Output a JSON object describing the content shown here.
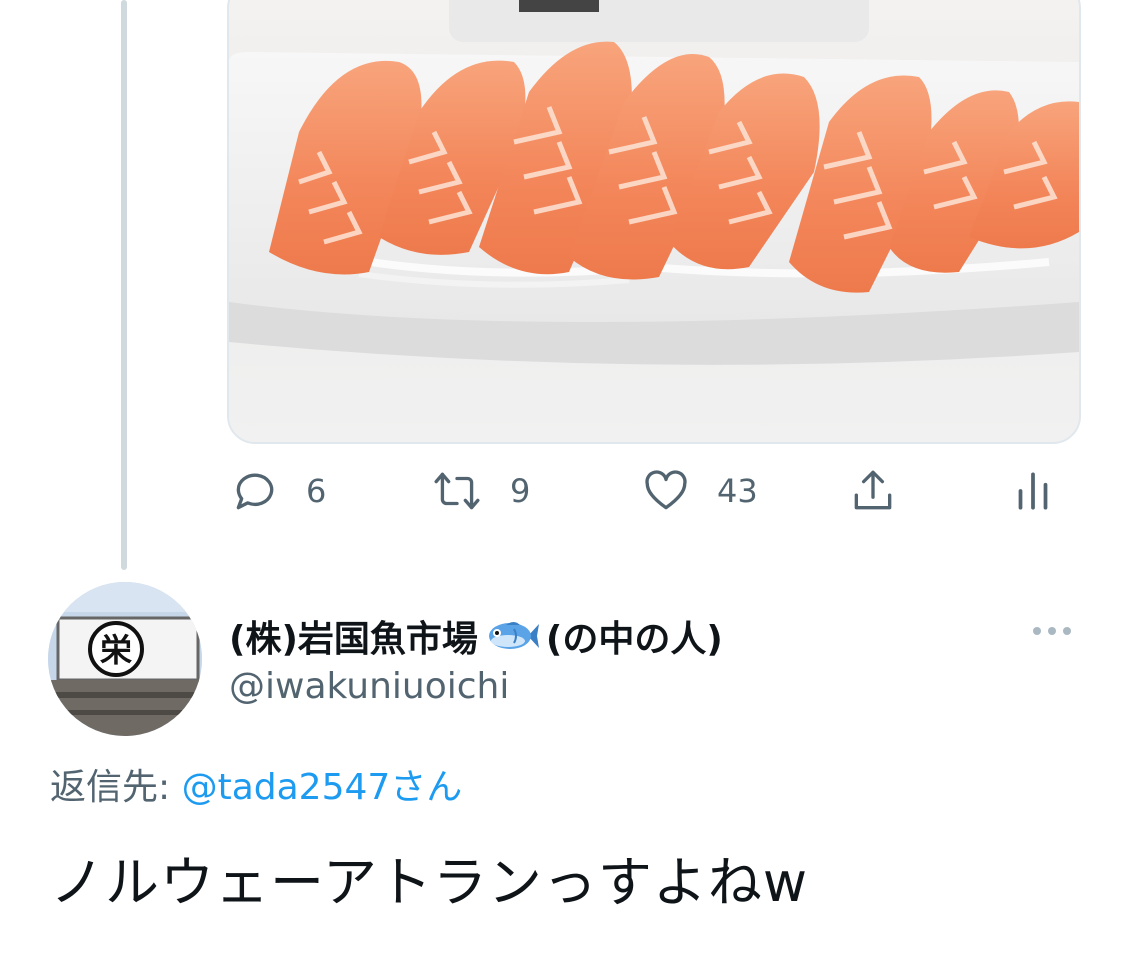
{
  "tweet_above": {
    "media_alt": "salmon sashimi on white plate",
    "actions": {
      "replies": "6",
      "retweets": "9",
      "likes": "43"
    }
  },
  "reply_tweet": {
    "display_name": "(株)岩国魚市場",
    "name_suffix": "(の中の人)",
    "emoji": "fish-emoji",
    "handle": "@iwakuniuoichi",
    "reply_label": "返信先: ",
    "reply_to": "@tada2547さん",
    "text": "ノルウェーアトランっすよねw",
    "avatar_sign_text": "栄"
  },
  "colors": {
    "link": "#1d9bf0",
    "secondary_text": "#536471",
    "thread_line": "#cfd9de"
  }
}
